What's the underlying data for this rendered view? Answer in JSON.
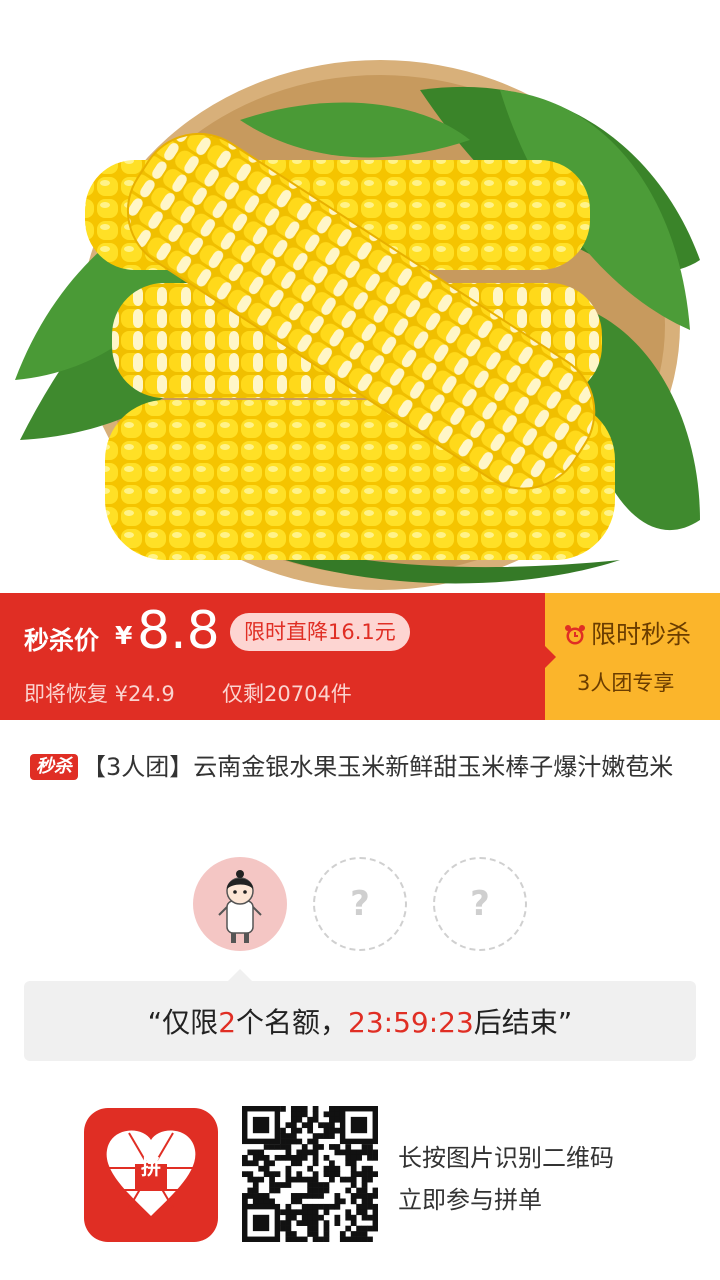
{
  "price_bar": {
    "seckill_label": "秒杀价",
    "currency": "¥",
    "price": "8.8",
    "drop_badge": "限时直降16.1元",
    "restore_text": "即将恢复 ¥24.9",
    "remaining_text": "仅剩20704件",
    "flash_title": "限时秒杀",
    "team_exclusive": "3人团专享"
  },
  "product": {
    "tag": "秒杀",
    "title": "【3人团】云南金银水果玉米新鲜甜玉米棒子爆汁嫩苞米"
  },
  "group": {
    "empty_slot_symbol": "?",
    "quota_prefix": "“仅限",
    "quota_count": "2",
    "quota_middle": "个名额，",
    "countdown": "23:59:23",
    "quota_suffix": "后结束”"
  },
  "footer": {
    "app_logo_text": "拼",
    "scan_line1": "长按图片识别二维码",
    "scan_line2": "立即参与拼单"
  },
  "colors": {
    "brand_red": "#e02e24",
    "flash_yellow": "#fbb52b"
  }
}
